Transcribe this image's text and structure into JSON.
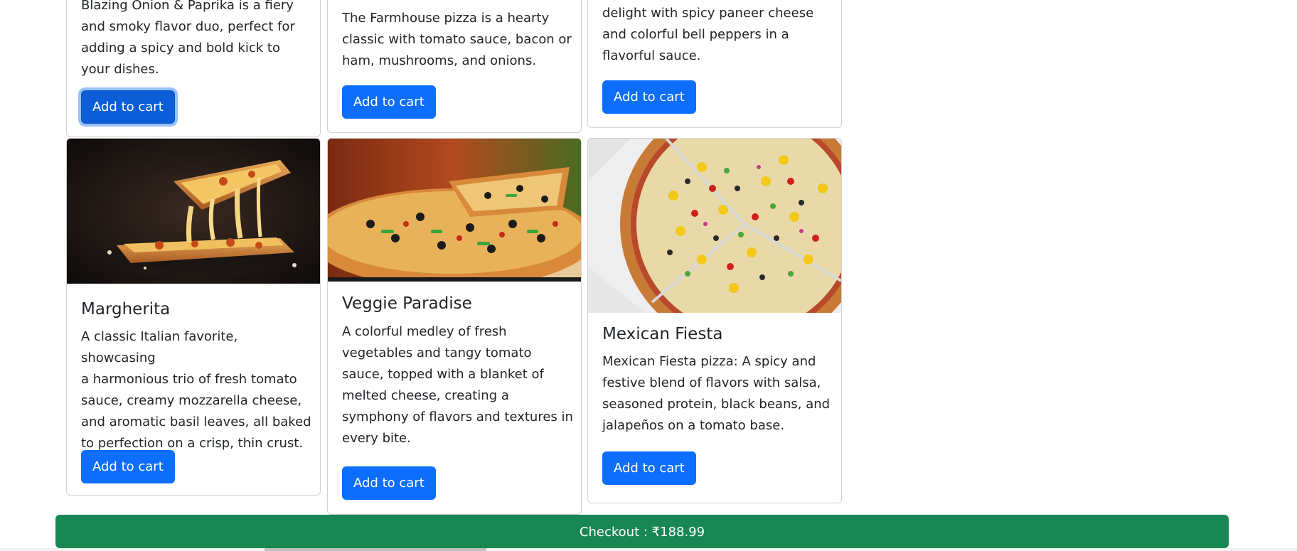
{
  "products": [
    {
      "title": "",
      "description_lines": [
        "Blazing Onion & Paprika is a fiery",
        "and smoky flavor duo, perfect for",
        "adding a spicy and bold kick to",
        "your dishes."
      ],
      "button_label": "Add to cart"
    },
    {
      "title": "",
      "description_lines": [
        "The Farmhouse pizza is a hearty",
        "classic with tomato sauce, bacon or",
        "ham, mushrooms, and onions."
      ],
      "button_label": "Add to cart"
    },
    {
      "title": "",
      "description_lines": [
        "delight with spicy paneer cheese",
        "and colorful bell peppers in a",
        "flavorful sauce."
      ],
      "button_label": "Add to cart"
    },
    {
      "title": "Margherita",
      "description_lines": [
        "A classic Italian favorite, showcasing",
        "a harmonious trio of fresh tomato",
        "sauce, creamy mozzarella cheese,",
        "and aromatic basil leaves, all baked",
        "to perfection on a crisp, thin crust."
      ],
      "button_label": "Add to cart"
    },
    {
      "title": "Veggie Paradise",
      "description_lines": [
        "A colorful medley of fresh",
        "vegetables and tangy tomato",
        "sauce, topped with a blanket of",
        "melted cheese, creating a",
        "symphony of flavors and textures in",
        "every bite."
      ],
      "button_label": "Add to cart"
    },
    {
      "title": "Mexican Fiesta",
      "description_lines": [
        "Mexican Fiesta pizza: A spicy and",
        "festive blend of flavors with salsa,",
        "seasoned protein, black beans, and",
        "jalapeños on a tomato base."
      ],
      "button_label": "Add to cart"
    }
  ],
  "checkout": {
    "label": "Checkout : ₹188.99"
  },
  "colors": {
    "primary": "#0d6efd",
    "success": "#198754",
    "text": "#212529"
  }
}
